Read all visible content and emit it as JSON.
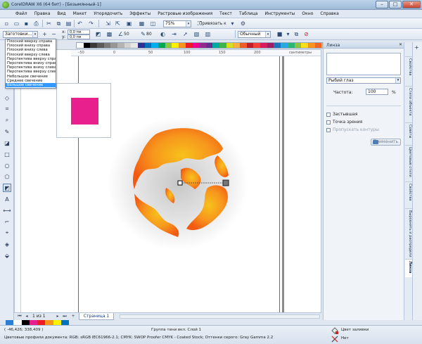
{
  "window": {
    "title": "CorelDRAW X6 (64 бит) - [Безымянный-1]",
    "buttons": {
      "minimize": "–",
      "maximize": "□",
      "close": "✕"
    }
  },
  "menu": [
    "Файл",
    "Правка",
    "Вид",
    "Макет",
    "Упорядочить",
    "Эффекты",
    "Растровые изображения",
    "Текст",
    "Таблица",
    "Инструменты",
    "Окно",
    "Справка"
  ],
  "toolbar": {
    "zoom": "75%",
    "snap_label": "Привязать к"
  },
  "propertybar": {
    "preset": "Заготовки...",
    "x_label": "x:",
    "x_value": "0,0 пм",
    "y_label": "y:",
    "y_value": "0,0 пм",
    "opacity": "50",
    "feather": "80",
    "merge_mode": "Обычный"
  },
  "preset_list": [
    "Плоский вверху справа",
    "Плоский внизу справа",
    "Плоский внизу слева",
    "Плоский вверху слева",
    "Перспектива вверху справа",
    "Перспектива внизу справа",
    "Перспектива внизу слева",
    "Перспектива вверху слева",
    "Небольшое свечение",
    "Среднее свечение",
    "Большое свечение"
  ],
  "preset_selected_index": 10,
  "ruler": {
    "units": "сантиметры"
  },
  "page_nav": {
    "page_info": "1 из 1",
    "tab": "Страница 1"
  },
  "docker": {
    "title": "Линза",
    "lens_type": "Рыбий глаз",
    "frequency_label": "Частота:",
    "frequency_value": "100",
    "frequency_unit": "%",
    "frozen": "Застывшая",
    "viewpoint": "Точка зрения",
    "remove_face": "Пропускать контуры",
    "apply": "Применить"
  },
  "docker_tabs": [
    "Свойства",
    "Стили объекта",
    "Советы",
    "Цветовые стили",
    "Свойства",
    "Выровнять и распределить",
    "Линза"
  ],
  "status": {
    "coords": "( -46,426; 338,409 )",
    "object_info": "Группа тени вкл. Слой 1",
    "color_profile": "Цветовые профили документа: RGB: sRGB IEC61966-2.1; CMYK: SWOP Proofer CMYK - Coated Stock; Оттенки серого: Gray Gamma 2.2",
    "fill_label": "Цвет заливки",
    "outline_label": "Нет"
  },
  "colors": {
    "accent": "#3399ff",
    "preview_fill": "#e8208e",
    "globe_light": "#f7c21b",
    "globe_dark": "#f25a12"
  }
}
